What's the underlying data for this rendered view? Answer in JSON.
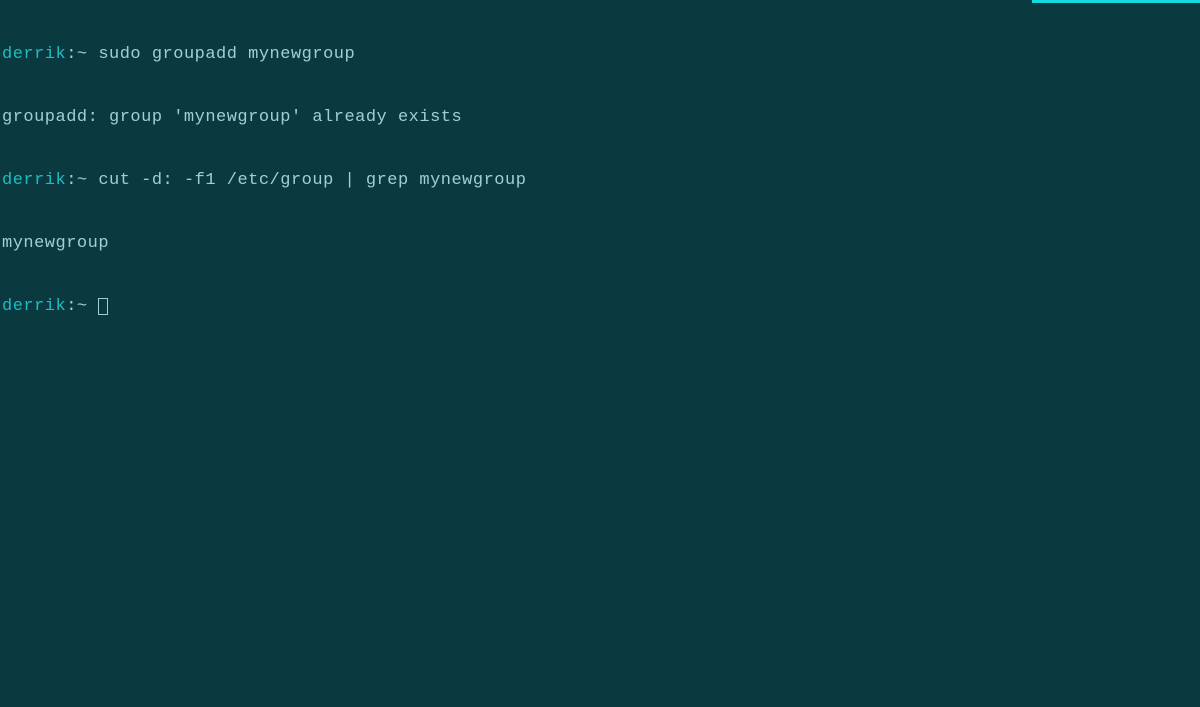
{
  "accent_color": "#15d8de",
  "lines": [
    {
      "type": "command",
      "prompt": {
        "user": "derrik",
        "sep": ":",
        "path": "~",
        "end": " "
      },
      "command": "sudo groupadd mynewgroup"
    },
    {
      "type": "output",
      "text": "groupadd: group 'mynewgroup' already exists"
    },
    {
      "type": "command",
      "prompt": {
        "user": "derrik",
        "sep": ":",
        "path": "~",
        "end": " "
      },
      "command": "cut -d: -f1 /etc/group | grep mynewgroup"
    },
    {
      "type": "output",
      "text": "mynewgroup"
    },
    {
      "type": "prompt_only",
      "prompt": {
        "user": "derrik",
        "sep": ":",
        "path": "~",
        "end": " "
      }
    }
  ]
}
